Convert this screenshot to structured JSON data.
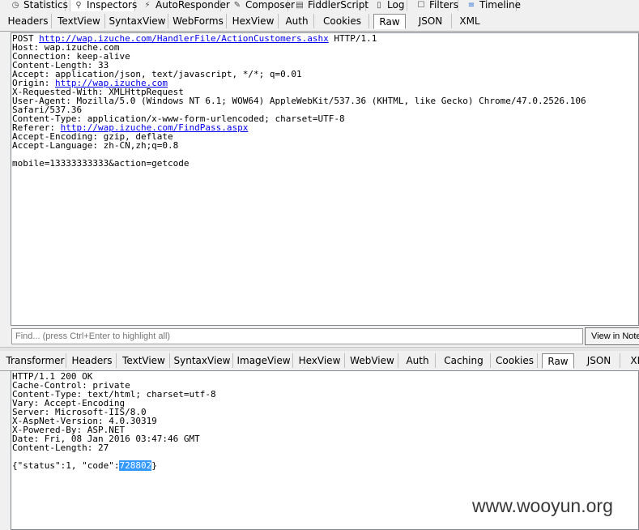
{
  "main_tabs": [
    {
      "label": "Statistics",
      "icon": "clock-icon"
    },
    {
      "label": "Inspectors",
      "icon": "magnifier-icon"
    },
    {
      "label": "AutoResponder",
      "icon": "lightning-icon"
    },
    {
      "label": "Composer",
      "icon": "composer-icon"
    },
    {
      "label": "FiddlerScript",
      "icon": "script-icon"
    },
    {
      "label": "Log",
      "icon": "log-icon"
    },
    {
      "label": "Filters",
      "icon": "checkbox-icon"
    },
    {
      "label": "Timeline",
      "icon": "timeline-icon"
    }
  ],
  "request_tabs": [
    "Headers",
    "TextView",
    "SyntaxView",
    "WebForms",
    "HexView",
    "Auth",
    "Cookies",
    "Raw",
    "JSON",
    "XML"
  ],
  "request": {
    "method": "POST",
    "url": "http://wap.izuche.com/HandlerFile/ActionCustomers.ashx",
    "protocol": " HTTP/1.1",
    "host": "Host: wap.izuche.com",
    "connection": "Connection: keep-alive",
    "content_length": "Content-Length: 33",
    "accept": "Accept: application/json, text/javascript, */*; q=0.01",
    "origin_label": "Origin: ",
    "origin_url": "http://wap.izuche.com",
    "x_requested_with": "X-Requested-With: XMLHttpRequest",
    "user_agent_1": "User-Agent: Mozilla/5.0 (Windows NT 6.1; WOW64) AppleWebKit/537.36 (KHTML, like Gecko) Chrome/47.0.2526.106",
    "user_agent_2": "Safari/537.36",
    "content_type": "Content-Type: application/x-www-form-urlencoded; charset=UTF-8",
    "referer_label": "Referer: ",
    "referer_url": "http://wap.izuche.com/FindPass.aspx",
    "accept_encoding": "Accept-Encoding: gzip, deflate",
    "accept_language": "Accept-Language: zh-CN,zh;q=0.8",
    "body": "mobile=13333333333&action=getcode"
  },
  "find": {
    "placeholder": "Find... (press Ctrl+Enter to highlight all)",
    "button_label": "View in Notepad"
  },
  "response_tabs": [
    "Transformer",
    "Headers",
    "TextView",
    "SyntaxView",
    "ImageView",
    "HexView",
    "WebView",
    "Auth",
    "Caching",
    "Cookies",
    "Raw",
    "JSON",
    "XML"
  ],
  "response": {
    "status": "HTTP/1.1 200 OK",
    "cache_control": "Cache-Control: private",
    "content_type": "Content-Type: text/html; charset=utf-8",
    "vary": "Vary: Accept-Encoding",
    "server": "Server: Microsoft-IIS/8.0",
    "aspnet_version": "X-AspNet-Version: 4.0.30319",
    "powered_by": "X-Powered-By: ASP.NET",
    "date": "Date: Fri, 08 Jan 2016 03:47:46 GMT",
    "content_length": "Content-Length: 27",
    "body_prefix": "{\"status\":1, \"code\":",
    "body_selected": "728802",
    "body_suffix": "}"
  },
  "watermark": "www.wooyun.org"
}
